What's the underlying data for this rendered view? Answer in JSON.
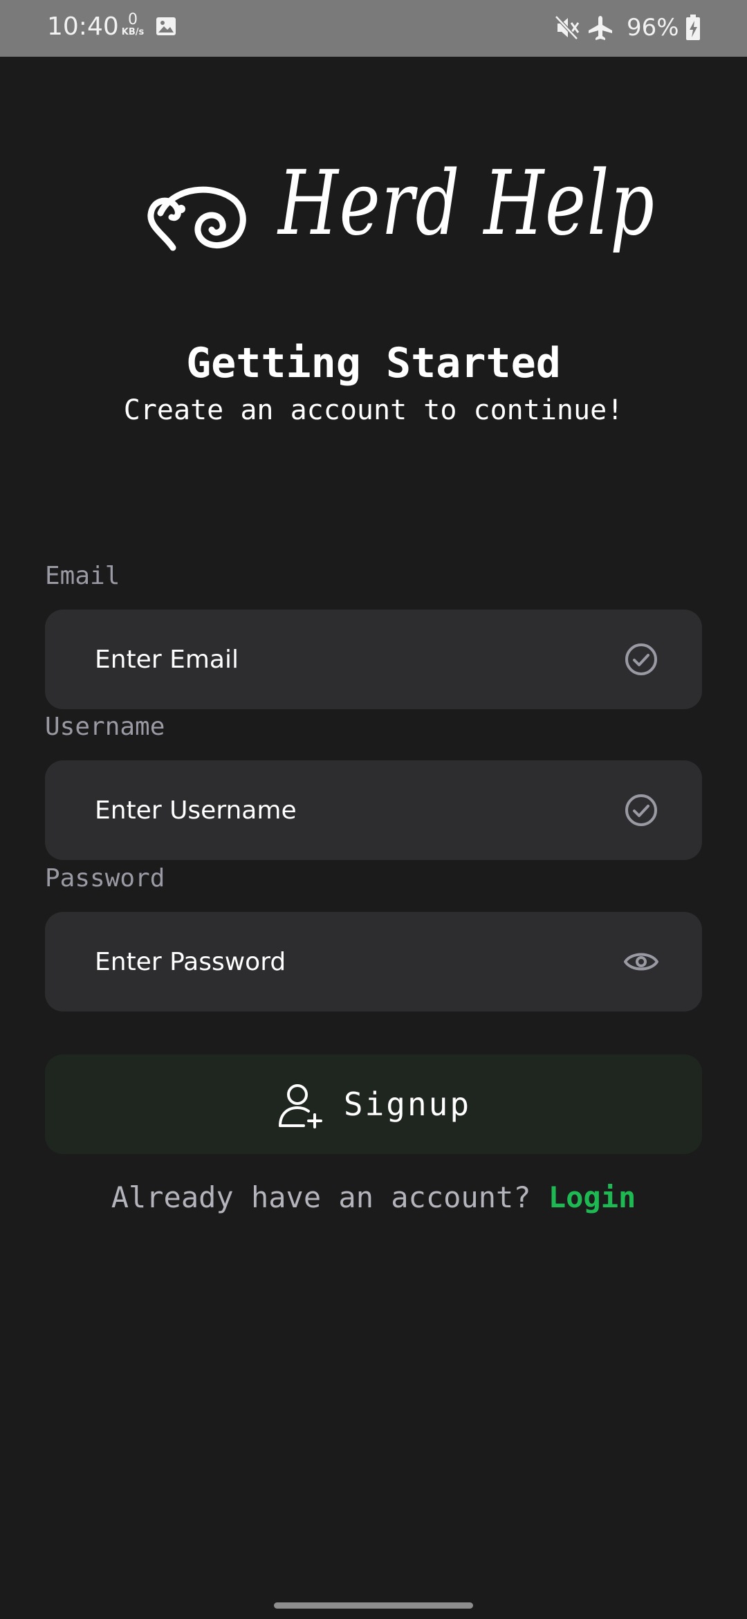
{
  "status_bar": {
    "time": "10:40",
    "net_speed_value": "0",
    "net_speed_unit": "KB/s",
    "battery_percent": "96%"
  },
  "app": {
    "name": "Herd Help"
  },
  "header": {
    "title": "Getting Started",
    "subtitle": "Create an account to continue!"
  },
  "form": {
    "email": {
      "label": "Email",
      "placeholder": "Enter Email",
      "value": "",
      "icon": "check-circle-icon"
    },
    "username": {
      "label": "Username",
      "placeholder": "Enter Username",
      "value": "",
      "icon": "check-circle-icon"
    },
    "password": {
      "label": "Password",
      "placeholder": "Enter Password",
      "value": "",
      "icon": "eye-icon"
    },
    "signup_label": "Signup",
    "signup_icon": "add-user-icon"
  },
  "footer": {
    "prompt": "Already have an account?",
    "login_label": "Login"
  },
  "colors": {
    "background": "#1b1b1b",
    "field_background": "#2d2d2f",
    "button_background": "#1f2620",
    "accent": "#1fb954",
    "label": "#9a9aa4"
  }
}
